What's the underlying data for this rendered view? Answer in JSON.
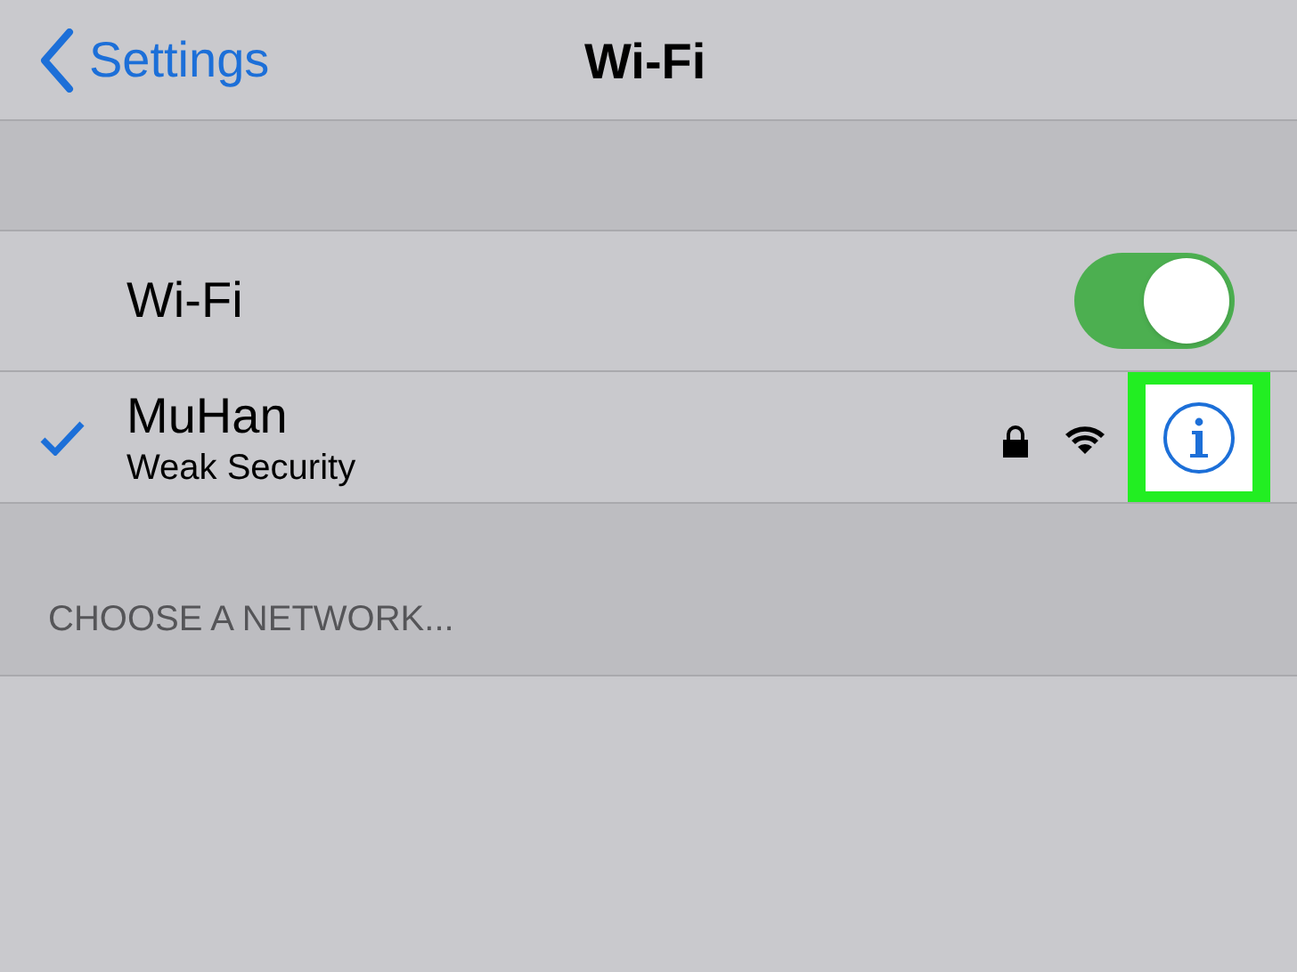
{
  "nav": {
    "back": "Settings",
    "title": "Wi-Fi"
  },
  "wifi_row": {
    "label": "Wi-Fi",
    "on": true
  },
  "networks": [
    {
      "name": "MuHan",
      "subtitle": "Weak Security",
      "selected": true,
      "locked": true,
      "highlighted": true
    }
  ],
  "section_header": "CHOOSE A NETWORK..."
}
